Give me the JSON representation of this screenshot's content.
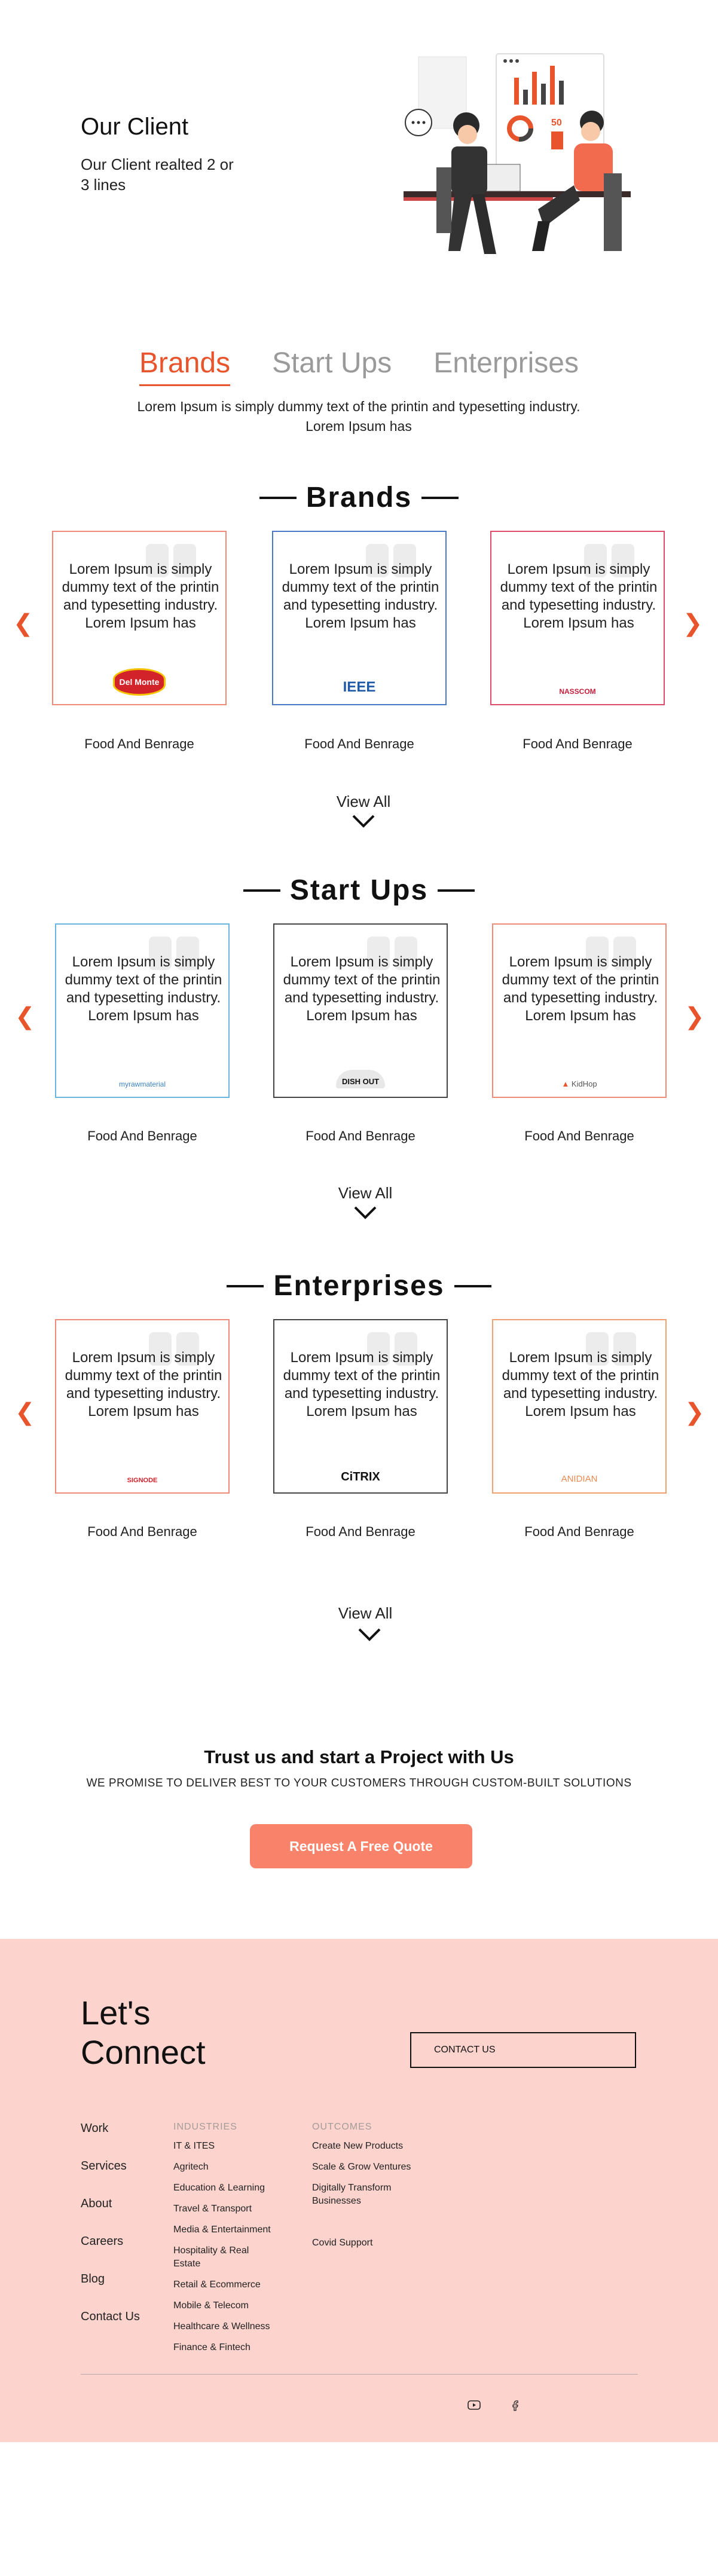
{
  "hero": {
    "title": "Our Client",
    "subtitle": "Our Client realted 2 or 3 lines"
  },
  "tabs": [
    {
      "label": "Brands",
      "active": true
    },
    {
      "label": "Start Ups",
      "active": false
    },
    {
      "label": "Enterprises",
      "active": false
    }
  ],
  "tab_desc": "Lorem Ipsum is simply dummy text of the printin and typesetting industry. Lorem Ipsum has",
  "card_text": "Lorem Ipsum is simply dummy text of the printin and typesetting industry. Lorem Ipsum has",
  "card_caption": "Food And Benrage",
  "view_all": "View All",
  "sections": [
    {
      "title": "Brands",
      "logos": [
        "Del Monte",
        "IEEE",
        "NASSCOM"
      ],
      "borders": [
        "#f08a78",
        "#4a78c8",
        "#e04a6a"
      ]
    },
    {
      "title": "Start Ups",
      "logos": [
        "myrawmaterial",
        "DISH OUT",
        "KidHop"
      ],
      "borders": [
        "#6ab4e0",
        "#444444",
        "#f08a78"
      ]
    },
    {
      "title": "Enterprises",
      "logos": [
        "SIGNODE",
        "CiTRIX",
        "ANIDIAN"
      ],
      "borders": [
        "#f08a78",
        "#444444",
        "#f0a070"
      ]
    }
  ],
  "cta": {
    "title": "Trust us and start a Project with Us",
    "subtitle": "WE PROMISE TO DELIVER BEST TO YOUR CUSTOMERS THROUGH CUSTOM-BUILT SOLUTIONS",
    "button": "Request A Free Quote"
  },
  "footer": {
    "heading": "Let's Connect",
    "contact_button": "CONTACT US",
    "nav": [
      "Work",
      "Services",
      "About",
      "Careers",
      "Blog",
      "Contact Us"
    ],
    "industries_title": "INDUSTRIES",
    "industries": [
      "IT & ITES",
      "Agritech",
      "Education & Learning",
      "Travel & Transport",
      "Media & Entertainment",
      "Hospitality & Real Estate",
      "Retail & Ecommerce",
      "Mobile & Telecom",
      "Healthcare & Wellness",
      "Finance & Fintech"
    ],
    "outcomes_title": "OUTCOMES",
    "outcomes": [
      "Create New Products",
      "Scale & Grow Ventures",
      "Digitally Transform Businesses",
      "Covid Support"
    ],
    "social": [
      "youtube-icon",
      "facebook-icon"
    ]
  },
  "colors": {
    "accent": "#e8542c",
    "cta": "#f9836a",
    "footer_bg": "#fcd3cd"
  }
}
